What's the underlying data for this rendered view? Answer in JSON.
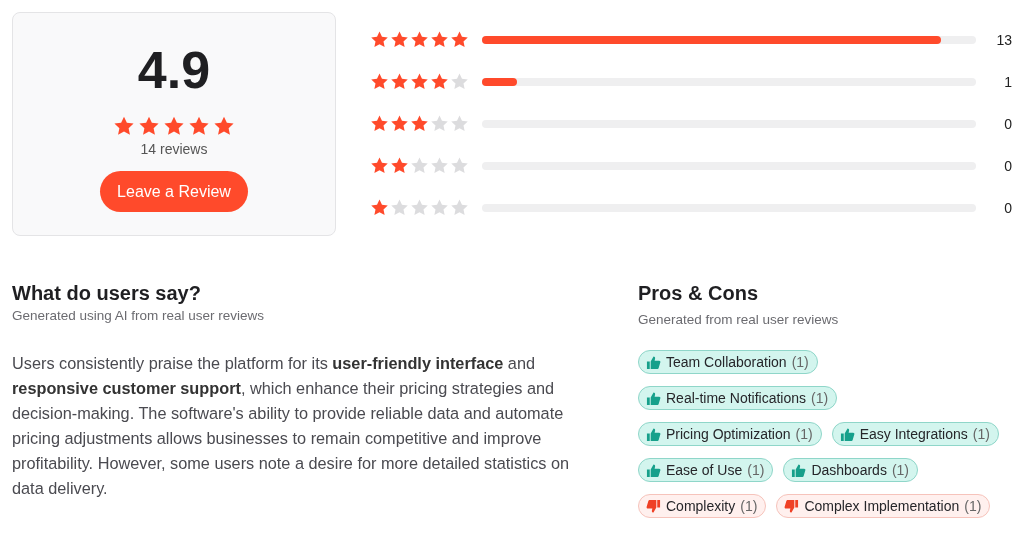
{
  "summary": {
    "score": "4.9",
    "stars": 5,
    "review_count": "14 reviews",
    "button": "Leave a Review"
  },
  "breakdown": [
    {
      "stars": 5,
      "level": 0.93,
      "count": "13"
    },
    {
      "stars": 4,
      "level": 0.07,
      "count": "1"
    },
    {
      "stars": 3,
      "count": "0"
    },
    {
      "stars": 2,
      "count": "0"
    },
    {
      "stars": 1,
      "count": "0"
    }
  ],
  "users_say": {
    "title": "What do users say?",
    "subtitle": "Generated using AI from real user reviews",
    "text": "Users consistently praise the platform for its **user-friendly interface** and **responsive customer support**, which enhance their pricing strategies and decision-making. The software's ability to provide reliable data and automate pricing adjustments allows businesses to remain competitive and improve profitability. However, some users note a desire for more detailed statistics on data delivery."
  },
  "pros_cons": {
    "title": "Pros & Cons",
    "subtitle": "Generated from real user reviews",
    "tags": [
      {
        "kind": "pro",
        "label": "Team Collaboration",
        "count": "(1)"
      },
      {
        "kind": "pro",
        "label": "Real-time Notifications",
        "count": "(1)"
      },
      {
        "kind": "pro",
        "label": "Pricing Optimization",
        "count": "(1)"
      },
      {
        "kind": "pro",
        "label": "Easy Integrations",
        "count": "(1)"
      },
      {
        "kind": "pro",
        "label": "Ease of Use",
        "count": "(1)"
      },
      {
        "kind": "pro",
        "label": "Dashboards",
        "count": "(1)"
      },
      {
        "kind": "con",
        "label": "Complexity",
        "count": "(1)"
      },
      {
        "kind": "con",
        "label": "Complex Implementation",
        "count": "(1)"
      }
    ]
  }
}
